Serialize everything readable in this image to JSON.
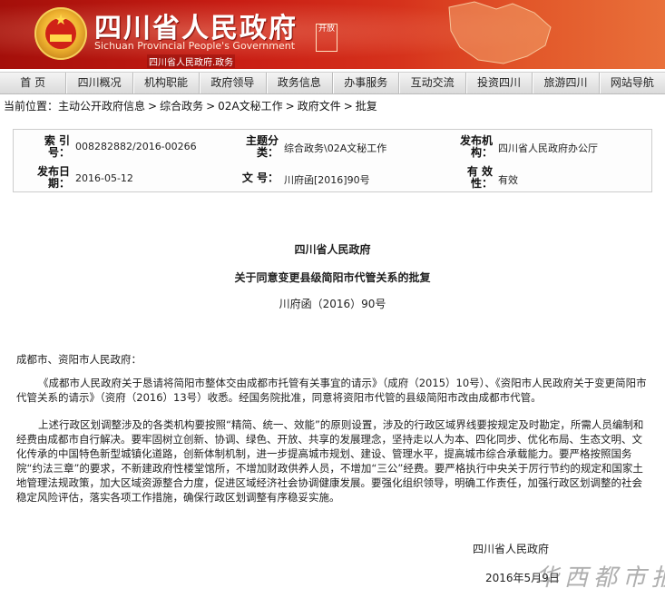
{
  "header": {
    "title": "四川省人民政府",
    "subtitle_en": "Sichuan Provincial People's Government",
    "subline": "四川省人民政府.政务",
    "seal_text": "开放"
  },
  "nav": [
    "首 页",
    "四川概况",
    "机构职能",
    "政府领导",
    "政务信息",
    "办事服务",
    "互动交流",
    "投资四川",
    "旅游四川",
    "网站导航"
  ],
  "breadcrumb": {
    "prefix": "当前位置：",
    "items": [
      "主动公开政府信息",
      "综合政务",
      "02A文秘工作",
      "政府文件",
      "批复"
    ],
    "separator": ">"
  },
  "meta": {
    "index_label": "索 引 号：",
    "index_value": "008282882/2016-00266",
    "category_label": "主题分 类：",
    "category_value": "综合政务\\02A文秘工作",
    "publisher_label": "发布机 构：",
    "publisher_value": "四川省人民政府办公厅",
    "date_label": "发布日 期：",
    "date_value": "2016-05-12",
    "docno_label": "文 号：",
    "docno_value": "川府函[2016]90号",
    "validity_label": "有 效 性：",
    "validity_value": "有效"
  },
  "document": {
    "org": "四川省人民政府",
    "title": "关于同意变更县级简阳市代管关系的批复",
    "number": "川府函（2016）90号",
    "salutation": "成都市、资阳市人民政府：",
    "para1": "《成都市人民政府关于恳请将简阳市整体交由成都市托管有关事宜的请示》（成府（2015）10号）、《资阳市人民政府关于变更简阳市代管关系的请示》（资府（2016）13号）收悉。经国务院批准，同意将资阳市代管的县级简阳市改由成都市代管。",
    "para2": "上述行政区划调整涉及的各类机构要按照“精简、统一、效能”的原则设置，涉及的行政区域界线要按规定及时勘定，所需人员编制和经费由成都市自行解决。要牢固树立创新、协调、绿色、开放、共享的发展理念，坚持走以人为本、四化同步、优化布局、生态文明、文化传承的中国特色新型城镇化道路，创新体制机制，进一步提高城市规划、建设、管理水平，提高城市综合承载能力。要严格按照国务院“约法三章”的要求，不新建政府性楼堂馆所，不增加财政供养人员，不增加“三公”经费。要严格执行中央关于厉行节约的规定和国家土地管理法规政策，加大区域资源整合力度，促进区域经济社会协调健康发展。要强化组织领导，明确工作责任，加强行政区划调整的社会稳定风险评估，落实各项工作措施，确保行政区划调整有序稳妥实施。",
    "signature_org": "四川省人民政府",
    "signature_date": "2016年5月9日"
  },
  "watermark": "华西都市报",
  "colors": {
    "banner_red": "#c81d14",
    "banner_orange": "#e9703a",
    "nav_bg": "#e6e6e6"
  }
}
